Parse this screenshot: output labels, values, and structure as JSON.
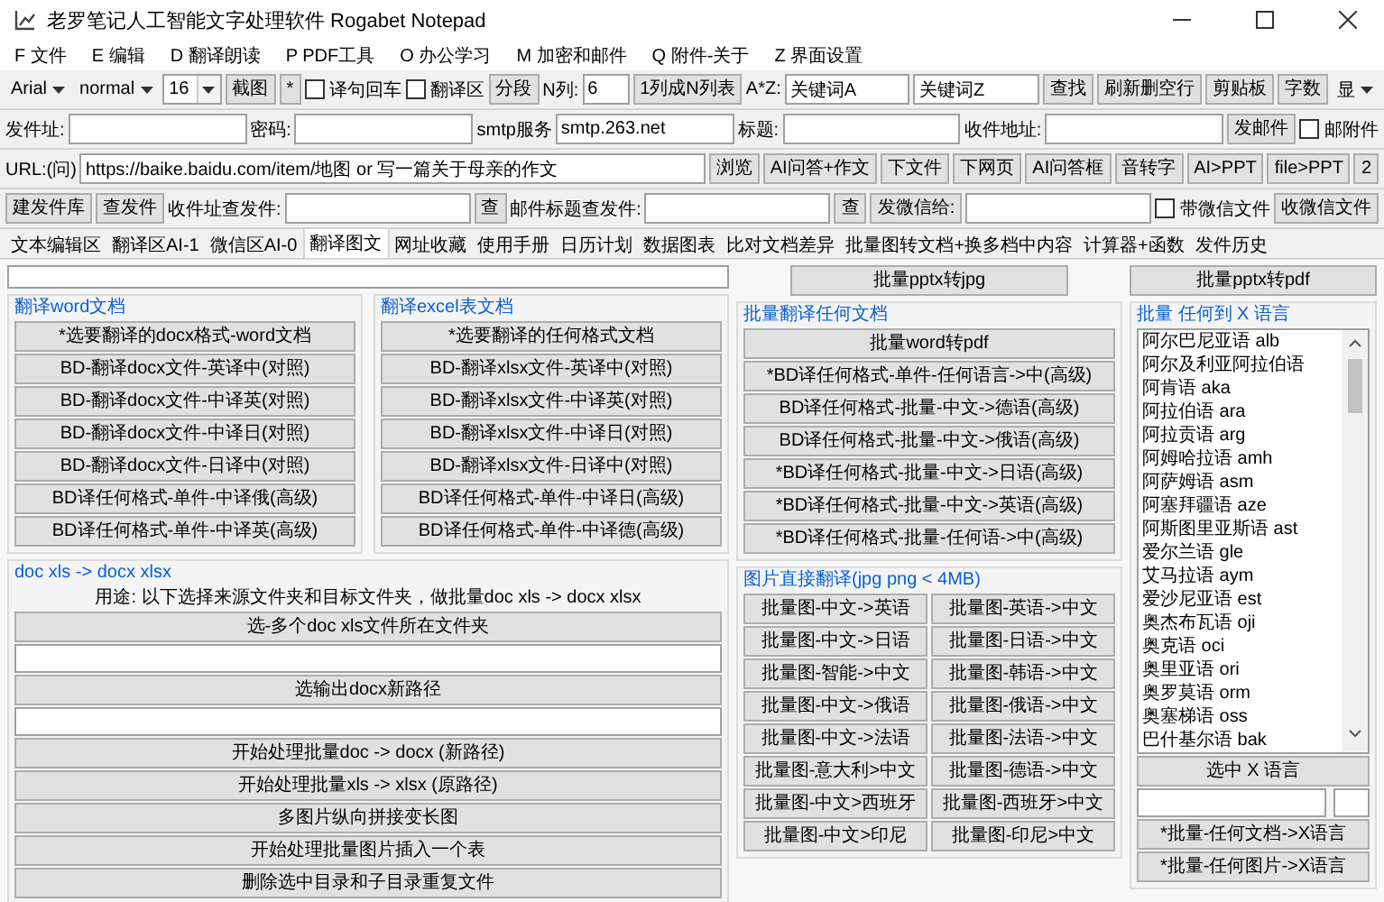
{
  "window": {
    "title": "老罗笔记人工智能文字处理软件 Rogabet Notepad"
  },
  "menu": [
    "F 文件",
    "E 编辑",
    "D 翻译朗读",
    "P PDF工具",
    "O 办公学习",
    "M 加密和邮件",
    "Q 附件-关于",
    "Z 界面设置"
  ],
  "toolbar_rows": [
    [
      {
        "kind": "dropdown",
        "value": "Arial"
      },
      {
        "kind": "dropdown",
        "value": "normal"
      },
      {
        "kind": "combo",
        "value": "16"
      },
      {
        "kind": "button",
        "label": "截图"
      },
      {
        "kind": "button",
        "label": "*"
      },
      {
        "kind": "checkbox",
        "label": "译句回车",
        "checked": false
      },
      {
        "kind": "checkbox",
        "label": "翻译区",
        "checked": false
      },
      {
        "kind": "button",
        "label": "分段"
      },
      {
        "kind": "label",
        "text": "N列:"
      },
      {
        "kind": "number_field",
        "value": "6"
      },
      {
        "kind": "button",
        "label": "1列成N列表"
      },
      {
        "kind": "label",
        "text": "A*Z:"
      },
      {
        "kind": "field",
        "value": "关键词A"
      },
      {
        "kind": "field",
        "value": "关键词Z"
      },
      {
        "kind": "button",
        "label": "查找"
      },
      {
        "kind": "button",
        "label": "刷新删空行"
      },
      {
        "kind": "button",
        "label": "剪贴板"
      },
      {
        "kind": "button",
        "label": "字数"
      },
      {
        "kind": "dropdown",
        "value": "显"
      }
    ],
    [
      {
        "kind": "label",
        "text": "发件址:"
      },
      {
        "kind": "field"
      },
      {
        "kind": "label",
        "text": "密码:"
      },
      {
        "kind": "field"
      },
      {
        "kind": "label",
        "text": "smtp服务"
      },
      {
        "kind": "field",
        "value": "smtp.263.net"
      },
      {
        "kind": "label",
        "text": "标题:"
      },
      {
        "kind": "field"
      },
      {
        "kind": "label",
        "text": "收件地址:"
      },
      {
        "kind": "field"
      },
      {
        "kind": "button",
        "label": "发邮件"
      },
      {
        "kind": "checkbox",
        "label": "邮附件",
        "checked": false
      }
    ],
    [
      {
        "kind": "label",
        "text": "URL:(问)"
      },
      {
        "kind": "wide_field",
        "value": "https://baike.baidu.com/item/地图 or 写一篇关于母亲的作文"
      },
      {
        "kind": "button",
        "label": "浏览"
      },
      {
        "kind": "button",
        "label": "AI问答+作文"
      },
      {
        "kind": "button",
        "label": "下文件"
      },
      {
        "kind": "button",
        "label": "下网页"
      },
      {
        "kind": "button",
        "label": "AI问答框"
      },
      {
        "kind": "button",
        "label": "音转字"
      },
      {
        "kind": "button",
        "label": "AI>PPT"
      },
      {
        "kind": "button",
        "label": "file>PPT"
      },
      {
        "kind": "button",
        "label": "2"
      }
    ],
    [
      {
        "kind": "button",
        "label": "建发件库"
      },
      {
        "kind": "button",
        "label": "查发件"
      },
      {
        "kind": "label",
        "text": "收件址查发件:"
      },
      {
        "kind": "field"
      },
      {
        "kind": "button",
        "label": "查"
      },
      {
        "kind": "label",
        "text": "邮件标题查发件:"
      },
      {
        "kind": "field"
      },
      {
        "kind": "button",
        "label": "查"
      },
      {
        "kind": "button",
        "label": "发微信给:"
      },
      {
        "kind": "field"
      },
      {
        "kind": "checkbox",
        "label": "带微信文件",
        "checked": false
      },
      {
        "kind": "button",
        "label": "收微信文件"
      }
    ]
  ],
  "tabs": [
    {
      "label": "文本编辑区",
      "selected": false
    },
    {
      "label": "翻译区AI-1",
      "selected": false
    },
    {
      "label": "微信区AI-0",
      "selected": false
    },
    {
      "label": "翻译图文",
      "selected": true
    },
    {
      "label": "网址收藏",
      "selected": false
    },
    {
      "label": "使用手册",
      "selected": false
    },
    {
      "label": "日历计划",
      "selected": false
    },
    {
      "label": "数据图表",
      "selected": false
    },
    {
      "label": "比对文档差异",
      "selected": false
    },
    {
      "label": "批量图转文档+换多档中内容",
      "selected": false
    },
    {
      "label": "计算器+函数",
      "selected": false
    },
    {
      "label": "发件历史",
      "selected": false
    }
  ],
  "pptx_buttons": [
    "批量pptx转jpg",
    "批量pptx转pdf"
  ],
  "word_group": {
    "title": "翻译word文档",
    "buttons": [
      "*选要翻译的docx格式-word文档",
      "BD-翻译docx文件-英译中(对照)",
      "BD-翻译docx文件-中译英(对照)",
      "BD-翻译docx文件-中译日(对照)",
      "BD-翻译docx文件-日译中(对照)",
      "BD译任何格式-单件-中译俄(高级)",
      "BD译任何格式-单件-中译英(高级)"
    ]
  },
  "excel_group": {
    "title": "翻译excel表文档",
    "buttons": [
      "*选要翻译的任何格式文档",
      "BD-翻译xlsx文件-英译中(对照)",
      "BD-翻译xlsx文件-中译英(对照)",
      "BD-翻译xlsx文件-中译日(对照)",
      "BD-翻译xlsx文件-日译中(对照)",
      "BD译任何格式-单件-中译日(高级)",
      "BD译任何格式-单件-中译德(高级)"
    ]
  },
  "doc_group": {
    "title": "doc xls -> docx xlsx",
    "note": "用途: 以下选择来源文件夹和目标文件夹，做批量doc xls -> docx xlsx",
    "items": [
      {
        "kind": "button",
        "label": "选-多个doc xls文件所在文件夹"
      },
      {
        "kind": "field"
      },
      {
        "kind": "button",
        "label": "选输出docx新路径"
      },
      {
        "kind": "field"
      },
      {
        "kind": "button",
        "label": "开始处理批量doc -> docx (新路径)"
      },
      {
        "kind": "button",
        "label": "开始处理批量xls -> xlsx (原路径)"
      },
      {
        "kind": "button",
        "label": "多图片纵向拼接变长图"
      },
      {
        "kind": "button",
        "label": "开始处理批量图片插入一个表"
      },
      {
        "kind": "button",
        "label": "删除选中目录和子目录重复文件"
      }
    ]
  },
  "batch_group": {
    "title": "批量翻译任何文档",
    "buttons": [
      "批量word转pdf",
      "*BD译任何格式-单件-任何语言->中(高级)",
      "BD译任何格式-批量-中文->德语(高级)",
      "BD译任何格式-批量-中文->俄语(高级)",
      "*BD译任何格式-批量-中文->日语(高级)",
      "*BD译任何格式-批量-中文->英语(高级)",
      "*BD译任何格式-批量-任何语->中(高级)"
    ]
  },
  "image_group": {
    "title": "图片直接翻译(jpg png < 4MB)",
    "buttons": [
      "批量图-中文->英语",
      "批量图-英语->中文",
      "批量图-中文->日语",
      "批量图-日语->中文",
      "批量图-智能->中文",
      "批量图-韩语->中文",
      "批量图-中文->俄语",
      "批量图-俄语->中文",
      "批量图-中文->法语",
      "批量图-法语->中文",
      "批量图-意大利>中文",
      "批量图-德语->中文",
      "批量图-中文>西班牙",
      "批量图-西班牙>中文",
      "批量图-中文>印尼",
      "批量图-印尼>中文"
    ]
  },
  "language_group": {
    "title": "批量 任何到 X 语言",
    "options": [
      {
        "label": "阿尔巴尼亚语 alb",
        "selected": false
      },
      {
        "label": "阿尔及利亚阿拉伯语",
        "selected": false
      },
      {
        "label": "阿肯语 aka",
        "selected": false
      },
      {
        "label": "阿拉伯语 ara",
        "selected": false
      },
      {
        "label": "阿拉贡语 arg",
        "selected": false
      },
      {
        "label": "阿姆哈拉语 amh",
        "selected": false
      },
      {
        "label": "阿萨姆语 asm",
        "selected": false
      },
      {
        "label": "阿塞拜疆语 aze",
        "selected": false
      },
      {
        "label": "阿斯图里亚斯语 ast",
        "selected": false
      },
      {
        "label": "爱尔兰语 gle",
        "selected": false
      },
      {
        "label": "艾马拉语 aym",
        "selected": false
      },
      {
        "label": "爱沙尼亚语 est",
        "selected": false
      },
      {
        "label": "奥杰布瓦语 oji",
        "selected": false
      },
      {
        "label": "奥克语 oci",
        "selected": false
      },
      {
        "label": "奥里亚语 ori",
        "selected": false
      },
      {
        "label": "奥罗莫语 orm",
        "selected": false
      },
      {
        "label": "奥塞梯语 oss",
        "selected": false
      },
      {
        "label": "巴什基尔语 bak",
        "selected": false
      }
    ],
    "select_button": "选中 X 语言",
    "buttons": [
      "*批量-任何文档->X语言",
      "*批量-任何图片->X语言"
    ]
  }
}
